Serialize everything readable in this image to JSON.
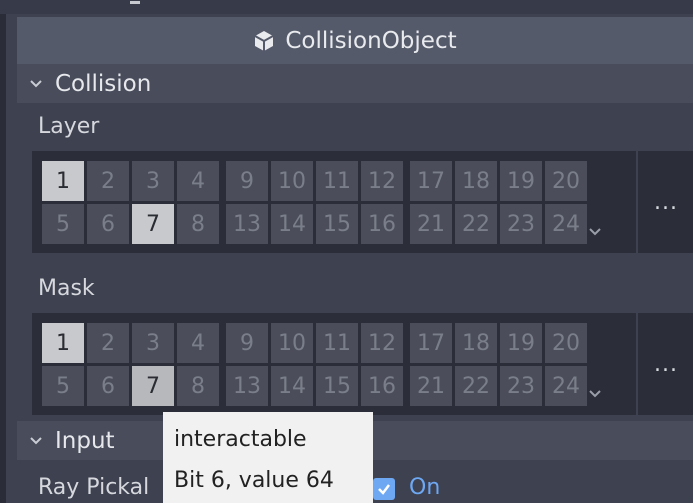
{
  "header": {
    "title": "CollisionObject",
    "icon": "cube-icon"
  },
  "sections": {
    "collision": "Collision",
    "input": "Input"
  },
  "layer": {
    "label": "Layer",
    "rows": [
      [
        "1",
        "2",
        "3",
        "4",
        "9",
        "10",
        "11",
        "12",
        "17",
        "18",
        "19",
        "20"
      ],
      [
        "5",
        "6",
        "7",
        "8",
        "13",
        "14",
        "15",
        "16",
        "21",
        "22",
        "23",
        "24"
      ]
    ],
    "enabled_bits": [
      "1",
      "7"
    ],
    "more": "..."
  },
  "mask": {
    "label": "Mask",
    "rows": [
      [
        "1",
        "2",
        "3",
        "4",
        "9",
        "10",
        "11",
        "12",
        "17",
        "18",
        "19",
        "20"
      ],
      [
        "5",
        "6",
        "7",
        "8",
        "13",
        "14",
        "15",
        "16",
        "21",
        "22",
        "23",
        "24"
      ]
    ],
    "enabled_bits": [
      "1",
      "7"
    ],
    "hovered_bit": "7",
    "more": "..."
  },
  "input": {
    "ray_pickable_label": "Ray Pickal",
    "ray_pickable_value": "On"
  },
  "tooltip": {
    "line1": "interactable",
    "line2": "Bit 6, value 64"
  },
  "colors": {
    "background": "#3d4150",
    "accent": "#6ea8f2",
    "cell": "#4b4e5a",
    "cell_on": "#c8c9cc"
  }
}
